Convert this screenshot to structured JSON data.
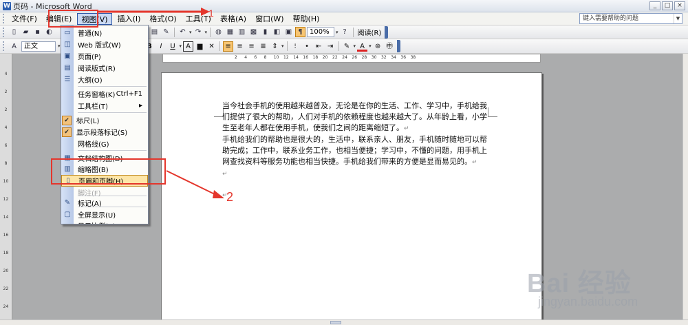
{
  "window": {
    "title": "页码 - Microsoft Word",
    "buttons": [
      "_",
      "□",
      "×"
    ]
  },
  "menubar": {
    "items": [
      "文件(F)",
      "编辑(E)",
      "视图(V)",
      "插入(I)",
      "格式(O)",
      "工具(T)",
      "表格(A)",
      "窗口(W)",
      "帮助(H)"
    ],
    "open_menu": "视图(V)",
    "help_placeholder": "键入需要帮助的问题"
  },
  "toolbar_standard": {
    "zoom": "100%",
    "read_label": "阅读(R)"
  },
  "toolbar_formatting": {
    "style": "正文",
    "bold": "B",
    "italic": "I",
    "underline": "U",
    "font_box_a": "A",
    "font_color_a": "A"
  },
  "view_menu": {
    "items": [
      {
        "label": "普通(N)",
        "icon": "normal-view-icon"
      },
      {
        "label": "Web 版式(W)",
        "icon": "web-layout-icon"
      },
      {
        "label": "页面(P)",
        "icon": "print-layout-icon"
      },
      {
        "label": "阅读版式(R)",
        "icon": "reading-layout-icon"
      },
      {
        "label": "大纲(O)",
        "icon": "outline-view-icon"
      },
      {
        "label": "任务窗格(K)",
        "shortcut": "Ctrl+F1"
      },
      {
        "label": "工具栏(T)",
        "submenu": true
      },
      {
        "label": "标尺(L)",
        "checked": true
      },
      {
        "label": "显示段落标记(S)",
        "checked": true
      },
      {
        "label": "网格线(G)"
      },
      {
        "label": "文档结构图(D)",
        "icon": "document-map-icon"
      },
      {
        "label": "缩略图(B)",
        "icon": "thumbnails-icon"
      },
      {
        "label": "页眉和页脚(H)",
        "icon": "header-footer-icon",
        "highlighted": true
      },
      {
        "label": "脚注(F)",
        "disabled": true
      },
      {
        "label": "标记(A)",
        "icon": "markup-icon"
      },
      {
        "label": "全屏显示(U)",
        "icon": "full-screen-icon"
      },
      {
        "label": "显示比例(Z)..."
      }
    ]
  },
  "document": {
    "paragraphs": [
      "当今社会手机的使用越来越普及，无论是在你的生活、工作、学习中，手机给我们提供了很大的帮助，人们对手机的依赖程度也越来越大了。从年龄上看，小学生至老年人都在使用手机，使我们之间的距离缩短了。",
      "手机给我们的帮助也是很大的，生活中，联系亲人、朋友，手机随时随地可以帮助完成；工作中，联系业务工作，也相当便捷；学习中，不懂的问题，用手机上网查找资料等服务功能也相当快捷。手机给我们带来的方便是显而易见的。"
    ],
    "paragraph_mark": "↵"
  },
  "annotations": {
    "step1": "1",
    "step2": "2",
    "color": "#e4362c"
  },
  "watermark": {
    "main": "Bai 经验",
    "sub": "jingyan.baidu.com"
  },
  "ruler": {
    "h_ticks": [
      "2",
      "4",
      "6",
      "8",
      "10",
      "12",
      "14",
      "16",
      "18",
      "20",
      "22",
      "24",
      "26",
      "28",
      "30",
      "32",
      "34",
      "36",
      "38"
    ],
    "v_ticks": [
      "4",
      "2",
      "2",
      "4",
      "6",
      "8",
      "10",
      "12",
      "14",
      "16",
      "18",
      "20",
      "22",
      "24"
    ]
  }
}
